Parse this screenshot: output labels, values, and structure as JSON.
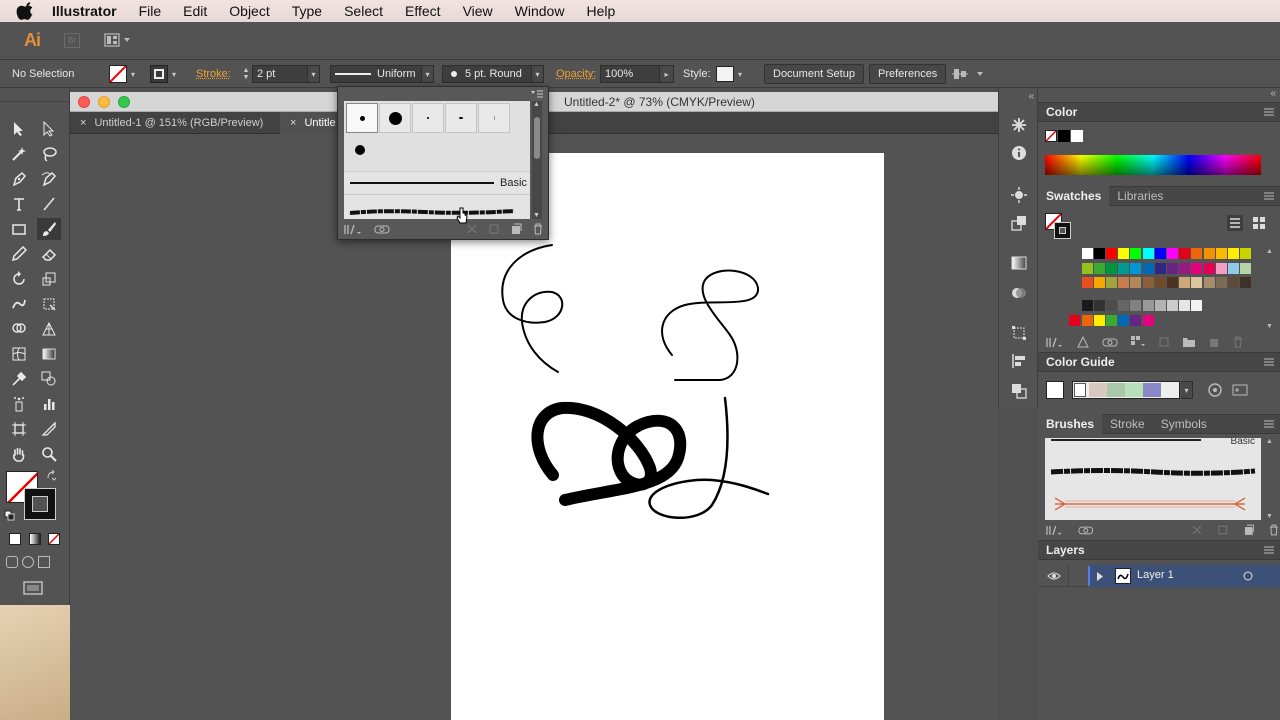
{
  "menubar": {
    "items": [
      {
        "label": "Illustrator",
        "app": true
      },
      {
        "label": "File"
      },
      {
        "label": "Edit"
      },
      {
        "label": "Object"
      },
      {
        "label": "Type"
      },
      {
        "label": "Select"
      },
      {
        "label": "Effect"
      },
      {
        "label": "View"
      },
      {
        "label": "Window"
      },
      {
        "label": "Help"
      }
    ]
  },
  "appbar": {
    "logo": "Ai",
    "bridge": "Br"
  },
  "controlbar": {
    "selection": "No Selection",
    "stroke_label": "Stroke:",
    "stroke_value": "2 pt",
    "profile": "Uniform",
    "brush": "5 pt. Round",
    "opacity_label": "Opacity:",
    "opacity_value": "100%",
    "style_label": "Style:",
    "document_setup": "Document Setup",
    "preferences": "Preferences"
  },
  "document": {
    "title": "Untitled-2* @ 73% (CMYK/Preview)",
    "tabs": [
      {
        "label": "Untitled-1 @ 151% (RGB/Preview)"
      },
      {
        "label": "Untitle"
      }
    ]
  },
  "brush_popup": {
    "basic_label": "Basic"
  },
  "panels": {
    "color": {
      "title": "Color"
    },
    "swatches": {
      "tab1": "Swatches",
      "tab2": "Libraries"
    },
    "color_guide": {
      "title": "Color Guide"
    },
    "brushes": {
      "tab1": "Brushes",
      "tab2": "Stroke",
      "tab3": "Symbols",
      "basic_label": "Basic"
    },
    "layers": {
      "title": "Layers",
      "layer_name": "Layer 1"
    }
  },
  "colors": {
    "accent_orange": "#f0a030",
    "panel_bg": "#535353",
    "canvas_bg": "#535353",
    "layer_highlight": "#3d5078",
    "swatches": [
      "#ffffff",
      "#000000",
      "#ff0000",
      "#ffff00",
      "#00ff00",
      "#00ffff",
      "#0000ff",
      "#ff00ff",
      "#e2001a",
      "#ec6608",
      "#f39200",
      "#fbba00",
      "#ffed00",
      "#c8d400",
      "#95c11f",
      "#3aaa35",
      "#00963f",
      "#009a93",
      "#0098d4",
      "#0069b4",
      "#312783",
      "#662483",
      "#951b81",
      "#e6007e",
      "#e50056",
      "#f29fc5",
      "#8fcae8",
      "#b5d5a4",
      "#e94e1b",
      "#f6a800",
      "#a0a43c",
      "#c77d4e",
      "#b2885a",
      "#8b5e3c",
      "#6e4a2f",
      "#4d3321",
      "#cfa87a",
      "#dcc6a0",
      "#a58d6e",
      "#7c6a55",
      "#5c4a3a",
      "#3d3128"
    ],
    "grays": [
      "#1a1a1a",
      "#333333",
      "#4d4d4d",
      "#666666",
      "#808080",
      "#999999",
      "#b3b3b3",
      "#cccccc",
      "#e6e6e6",
      "#f2f2f2"
    ],
    "bottom_row": [
      "#e2001a",
      "#ec6608",
      "#ffed00",
      "#3aaa35",
      "#0069b4",
      "#662483",
      "#e6007e"
    ],
    "guide": [
      "#d8c8c0",
      "#a8c8a8",
      "#b8e0b8",
      "#8888c8"
    ]
  }
}
